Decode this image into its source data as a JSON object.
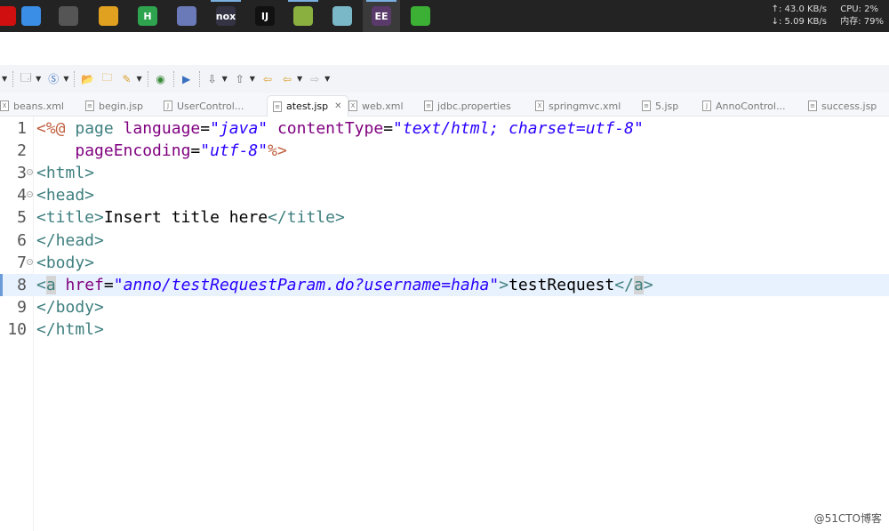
{
  "taskbar": {
    "apps": [
      {
        "name": "app-red",
        "label": "",
        "color": "#d01010"
      },
      {
        "name": "baidu-netdisk",
        "label": "",
        "color": "#3a8ee6"
      },
      {
        "name": "remote-desktop",
        "label": "",
        "color": "#555555"
      },
      {
        "name": "chrome",
        "label": "",
        "color": "#e0a020"
      },
      {
        "name": "hbuilder",
        "label": "H",
        "color": "#2ea44f"
      },
      {
        "name": "mysql-dolphin",
        "label": "",
        "color": "#6a7ab8"
      },
      {
        "name": "nox",
        "label": "nox",
        "color": "#333344"
      },
      {
        "name": "intellij-idea",
        "label": "IJ",
        "color": "#111111"
      },
      {
        "name": "notepad-plus",
        "label": "",
        "color": "#8ab040"
      },
      {
        "name": "notes",
        "label": "",
        "color": "#7ab8c8"
      },
      {
        "name": "eclipse-javaee",
        "label": "EE",
        "color": "#5a3a6a"
      },
      {
        "name": "wechat",
        "label": "",
        "color": "#3cb034"
      }
    ],
    "net_up": "↑: 43.0 KB/s",
    "net_down": "↓: 5.09 KB/s",
    "cpu": "CPU: 2%",
    "mem": "内存: 79%"
  },
  "tabs": [
    {
      "label": "beans.xml",
      "type": "X"
    },
    {
      "label": "begin.jsp",
      "type": "≡"
    },
    {
      "label": "UserControl...",
      "type": "J"
    },
    {
      "label": "atest.jsp",
      "type": "≡",
      "active": true
    },
    {
      "label": "web.xml",
      "type": "X"
    },
    {
      "label": "jdbc.properties",
      "type": "≡"
    },
    {
      "label": "springmvc.xml",
      "type": "X"
    },
    {
      "label": "5.jsp",
      "type": "≡"
    },
    {
      "label": "AnnoControl...",
      "type": "J"
    },
    {
      "label": "success.jsp",
      "type": "≡"
    }
  ],
  "editor": {
    "current_line": 8,
    "lines": [
      {
        "n": "1",
        "fold": false,
        "tokens": [
          [
            "jsp",
            "<%@ "
          ],
          [
            "tag",
            "page "
          ],
          [
            "attr",
            "language"
          ],
          [
            "txt",
            "="
          ],
          [
            "str",
            "\"java\""
          ],
          [
            "txt",
            " "
          ],
          [
            "attr",
            "contentType"
          ],
          [
            "txt",
            "="
          ],
          [
            "str",
            "\"text/html; charset=utf-8\""
          ]
        ]
      },
      {
        "n": "2",
        "fold": false,
        "tokens": [
          [
            "txt",
            "    "
          ],
          [
            "attr",
            "pageEncoding"
          ],
          [
            "txt",
            "="
          ],
          [
            "str",
            "\"utf-8\""
          ],
          [
            "jsp",
            "%>"
          ]
        ]
      },
      {
        "n": "3",
        "fold": true,
        "tokens": [
          [
            "tag",
            "<html>"
          ]
        ]
      },
      {
        "n": "4",
        "fold": true,
        "tokens": [
          [
            "tag",
            "<head>"
          ]
        ]
      },
      {
        "n": "5",
        "fold": false,
        "tokens": [
          [
            "tag",
            "<title>"
          ],
          [
            "txt",
            "Insert title here"
          ],
          [
            "tag",
            "</title>"
          ]
        ]
      },
      {
        "n": "6",
        "fold": false,
        "tokens": [
          [
            "tag",
            "</head>"
          ]
        ]
      },
      {
        "n": "7",
        "fold": true,
        "tokens": [
          [
            "tag",
            "<body>"
          ]
        ]
      },
      {
        "n": "8",
        "fold": false,
        "tokens": [
          [
            "tag",
            "<"
          ],
          [
            "hl",
            "a"
          ],
          [
            "txt",
            " "
          ],
          [
            "attr",
            "href"
          ],
          [
            "txt",
            "="
          ],
          [
            "str",
            "\"anno/testRequestParam.do?username=haha\""
          ],
          [
            "tag",
            ">"
          ],
          [
            "txt",
            "testRequest"
          ],
          [
            "tag",
            "</"
          ],
          [
            "hl",
            "a"
          ],
          [
            "tag",
            ">"
          ]
        ]
      },
      {
        "n": "9",
        "fold": false,
        "tokens": [
          [
            "tag",
            "</body>"
          ]
        ]
      },
      {
        "n": "10",
        "fold": false,
        "tokens": [
          [
            "tag",
            "</html>"
          ]
        ]
      }
    ]
  },
  "watermark": "@51CTO博客"
}
